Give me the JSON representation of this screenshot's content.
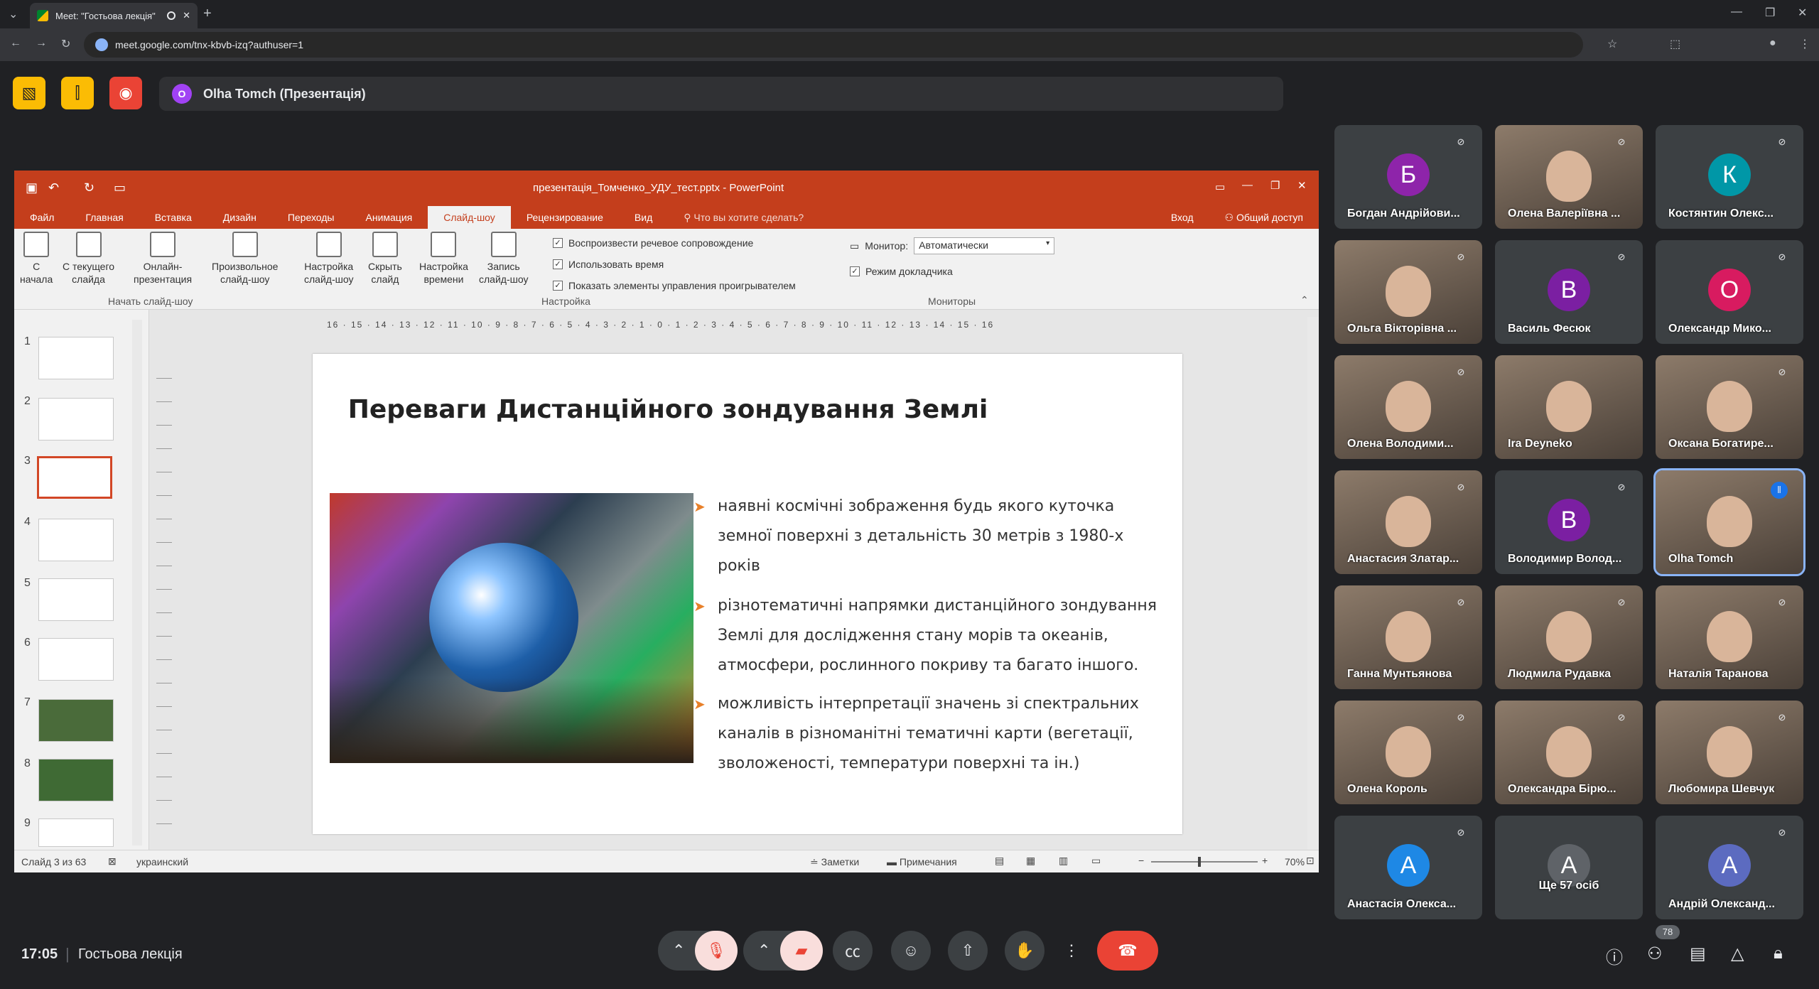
{
  "browser": {
    "tab_title": "Meet: \"Гостьова лекція\"",
    "url": "meet.google.com/tnx-kbvb-izq?authuser=1"
  },
  "meet": {
    "presenter_initial": "O",
    "presenter_label": "Olha Tomch (Презентація)",
    "time": "17:05",
    "meeting_name": "Гостьова лекція",
    "participant_badge": "78"
  },
  "ppt": {
    "window_title": "презентація_Томченко_УДУ_тест.pptx - PowerPoint",
    "menu": [
      "Файл",
      "Главная",
      "Вставка",
      "Дизайн",
      "Переходы",
      "Анимация",
      "Слайд-шоу",
      "Рецензирование",
      "Вид"
    ],
    "tell_me": "Что вы хотите сделать?",
    "signin": "Вход",
    "share": "Общий доступ",
    "ribbon": {
      "from_start": [
        "С",
        "начала"
      ],
      "from_current": [
        "С текущего",
        "слайда"
      ],
      "online": [
        "Онлайн-",
        "презентация"
      ],
      "custom": [
        "Произвольное",
        "слайд-шоу"
      ],
      "setup": [
        "Настройка",
        "слайд-шоу"
      ],
      "hide": [
        "Скрыть",
        "слайд"
      ],
      "rehearse": [
        "Настройка",
        "времени"
      ],
      "record": [
        "Запись",
        "слайд-шоу"
      ],
      "group_start": "Начать слайд-шоу",
      "cb_narration": "Воспроизвести речевое сопровождение",
      "cb_timings": "Использовать время",
      "cb_controls": "Показать элементы управления проигрывателем",
      "group_setup": "Настройка",
      "monitor_label": "Монитор:",
      "monitor_value": "Автоматически",
      "presenter_view": "Режим докладчика",
      "group_monitors": "Мониторы"
    },
    "ruler": "16 · 15 · 14 · 13 · 12 · 11 · 10 · 9 · 8 · 7 · 6 · 5 · 4 · 3 · 2 · 1 · 0 · 1 · 2 · 3 · 4 · 5 · 6 · 7 · 8 · 9 · 10 · 11 · 12 · 13 · 14 · 15 · 16",
    "thumb_numbers": [
      "1",
      "2",
      "3",
      "4",
      "5",
      "6",
      "7",
      "8",
      "9"
    ],
    "slide": {
      "title": "Переваги Дистанційного зондування Землі",
      "bullets": [
        [
          "наявні космічні зображення  будь якого куточка",
          "земної  поверхні з  детальність 30  метрів з 1980-х",
          "років"
        ],
        [
          "різнотематичні напрямки дистанційного зондування",
          "Землі для дослідження стану морів та океанів,",
          "атмосфери,  рослинного покриву та багато іншого."
        ],
        [
          "можливість інтерпретації  значень зі  спектральних",
          "каналів в різноманітні тематичні  карти (вегетації,",
          "зволоженості,  температури поверхні та ін.)"
        ]
      ]
    },
    "status": {
      "slide_of": "Слайд 3 из 63",
      "language": "украинский",
      "notes": "Заметки",
      "comments": "Примечания",
      "zoom": "70%"
    }
  },
  "participants": [
    {
      "name": "Богдан Андрійови...",
      "initial": "Б",
      "color": "#8e24aa"
    },
    {
      "name": "Олена Валеріївна ...",
      "initial": "",
      "color": ""
    },
    {
      "name": "Костянтин Олекс...",
      "initial": "К",
      "color": "#0097a7"
    },
    {
      "name": "Ольга Вікторівна ...",
      "initial": "",
      "color": ""
    },
    {
      "name": "Василь Фесюк",
      "initial": "В",
      "color": "#7b1fa2"
    },
    {
      "name": "Олександр Мико...",
      "initial": "О",
      "color": "#d81b60"
    },
    {
      "name": "Олена Володими...",
      "initial": "",
      "color": ""
    },
    {
      "name": "Ira Deyneko",
      "initial": "",
      "color": ""
    },
    {
      "name": "Оксана Богатире...",
      "initial": "",
      "color": ""
    },
    {
      "name": "Анастасия Златар...",
      "initial": "",
      "color": ""
    },
    {
      "name": "Володимир Волод...",
      "initial": "В",
      "color": "#7b1fa2"
    },
    {
      "name": "Olha Tomch",
      "initial": "",
      "color": ""
    },
    {
      "name": "Ганна Мунтьянова",
      "initial": "",
      "color": ""
    },
    {
      "name": "Людмила Рудавка",
      "initial": "",
      "color": ""
    },
    {
      "name": "Наталія Таранова",
      "initial": "",
      "color": ""
    },
    {
      "name": "Олена Король",
      "initial": "",
      "color": ""
    },
    {
      "name": "Олександра Бірю...",
      "initial": "",
      "color": ""
    },
    {
      "name": "Любомира Шевчук",
      "initial": "",
      "color": ""
    },
    {
      "name": "Анастасія Олекса...",
      "initial": "А",
      "color": "#1e88e5"
    },
    {
      "name": "Ще 57 осіб",
      "initial": "А",
      "color": "#5f6368"
    },
    {
      "name": "Андрій Олександ...",
      "initial": "А",
      "color": "#5c6bc0"
    }
  ]
}
